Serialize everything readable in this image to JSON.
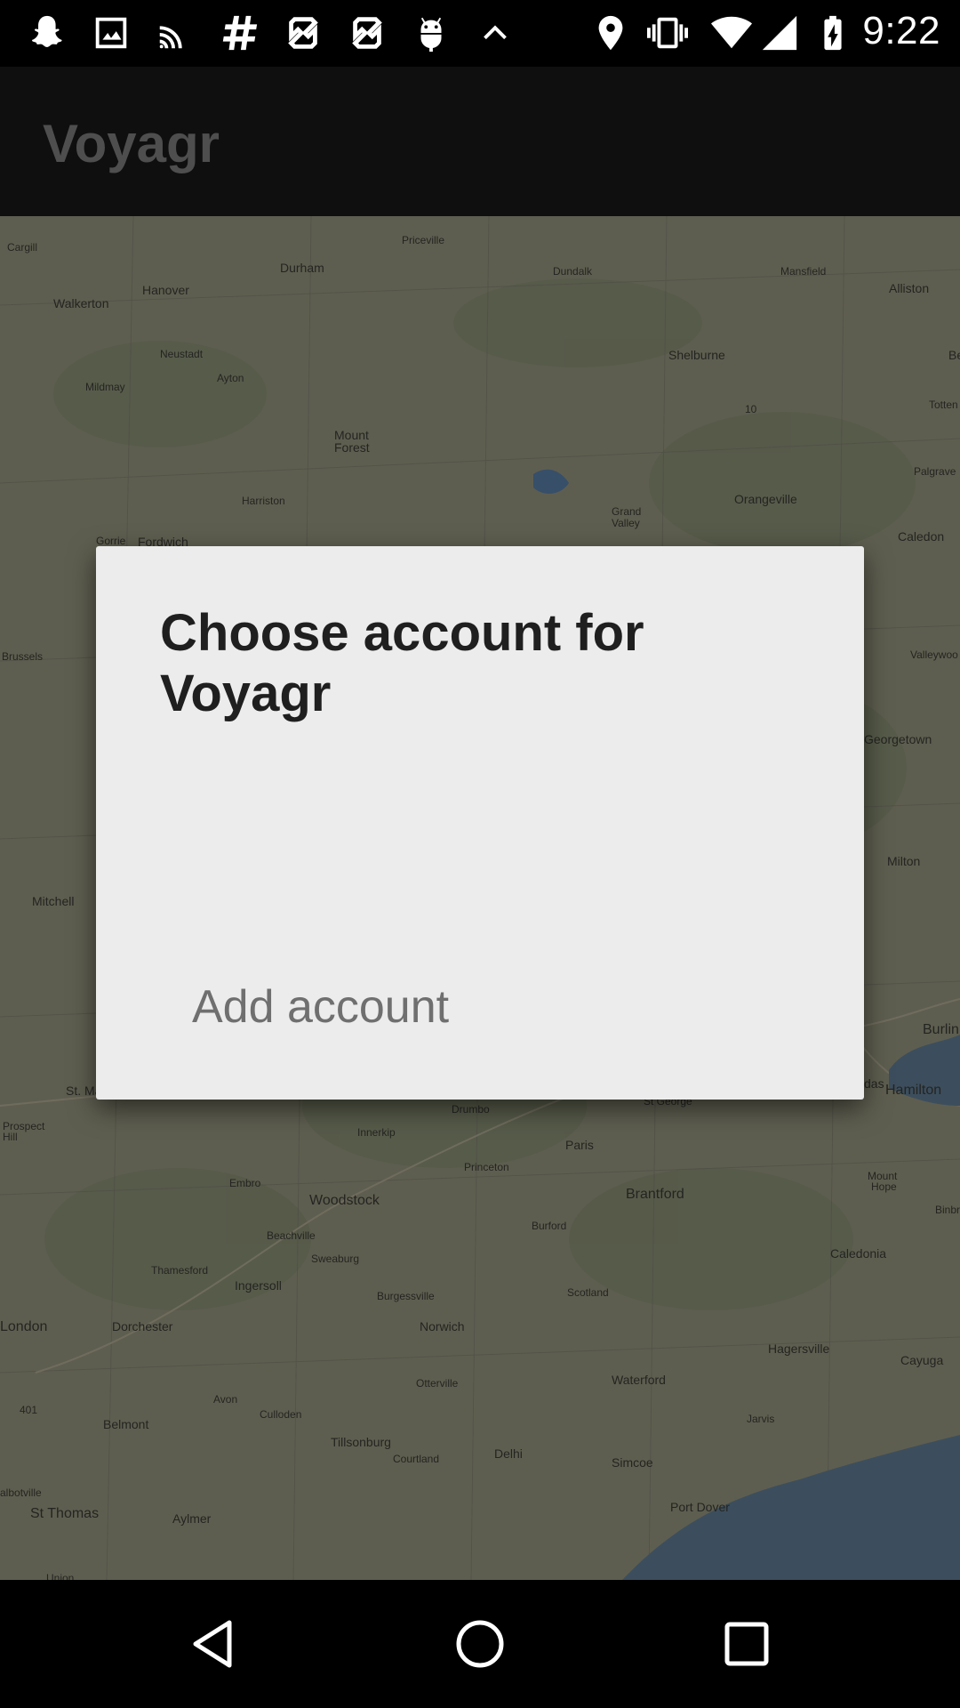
{
  "status_bar": {
    "time": "9:22",
    "icons": [
      "snapchat-icon",
      "gallery-icon",
      "cast-icon",
      "slack-icon",
      "sync-icon",
      "sync-icon",
      "android-debug-icon",
      "chevron-up-icon",
      "location-icon",
      "vibrate-icon",
      "wifi-icon",
      "signal-icon",
      "battery-charging-icon"
    ]
  },
  "app_bar": {
    "title": "Voyagr"
  },
  "map": {
    "labels": [
      {
        "text": "Cargill",
        "size": "sm"
      },
      {
        "text": "Priceville",
        "size": "sm"
      },
      {
        "text": "Durham",
        "size": "md"
      },
      {
        "text": "Dundalk",
        "size": "sm"
      },
      {
        "text": "Mansfield",
        "size": "sm"
      },
      {
        "text": "Alliston",
        "size": "md"
      },
      {
        "text": "Hanover",
        "size": "md"
      },
      {
        "text": "Walkerton",
        "size": "md"
      },
      {
        "text": "Neustadt",
        "size": "sm"
      },
      {
        "text": "Shelburne",
        "size": "md"
      },
      {
        "text": "Be",
        "size": "md"
      },
      {
        "text": "Mildmay",
        "size": "sm"
      },
      {
        "text": "Ayton",
        "size": "sm"
      },
      {
        "text": "10",
        "size": "sm"
      },
      {
        "text": "Totten",
        "size": "sm"
      },
      {
        "text": "Mount",
        "size": "md"
      },
      {
        "text": "Forest",
        "size": "md"
      },
      {
        "text": "Palgrave",
        "size": "sm"
      },
      {
        "text": "Harriston",
        "size": "sm"
      },
      {
        "text": "Orangeville",
        "size": "md"
      },
      {
        "text": "Grand",
        "size": "sm"
      },
      {
        "text": "Valley",
        "size": "sm"
      },
      {
        "text": "Gorrie",
        "size": "sm"
      },
      {
        "text": "Fordwich",
        "size": "md"
      },
      {
        "text": "Caledon",
        "size": "md"
      },
      {
        "text": "Brussels",
        "size": "sm"
      },
      {
        "text": "Valleywoo",
        "size": "sm"
      },
      {
        "text": "Georgetown",
        "size": "md"
      },
      {
        "text": "Milton",
        "size": "md"
      },
      {
        "text": "Mitchell",
        "size": "md"
      },
      {
        "text": "Burlin",
        "size": "lg"
      },
      {
        "text": "St. Ma",
        "size": "md"
      },
      {
        "text": "Drumbo",
        "size": "sm"
      },
      {
        "text": "St George",
        "size": "sm"
      },
      {
        "text": "das",
        "size": "md"
      },
      {
        "text": "Hamilton",
        "size": "lg"
      },
      {
        "text": "Prospect",
        "size": "sm"
      },
      {
        "text": "Hill",
        "size": "sm"
      },
      {
        "text": "Innerkip",
        "size": "sm"
      },
      {
        "text": "Paris",
        "size": "md"
      },
      {
        "text": "Princeton",
        "size": "sm"
      },
      {
        "text": "Mount",
        "size": "sm"
      },
      {
        "text": "Hope",
        "size": "sm"
      },
      {
        "text": "Embro",
        "size": "sm"
      },
      {
        "text": "Woodstock",
        "size": "lg"
      },
      {
        "text": "Brantford",
        "size": "lg"
      },
      {
        "text": "Binbr",
        "size": "sm"
      },
      {
        "text": "Burford",
        "size": "sm"
      },
      {
        "text": "Beachville",
        "size": "sm"
      },
      {
        "text": "Caledonia",
        "size": "md"
      },
      {
        "text": "Sweaburg",
        "size": "sm"
      },
      {
        "text": "Thamesford",
        "size": "sm"
      },
      {
        "text": "Ingersoll",
        "size": "md"
      },
      {
        "text": "Scotland",
        "size": "sm"
      },
      {
        "text": "Burgessville",
        "size": "sm"
      },
      {
        "text": "London",
        "size": "lg"
      },
      {
        "text": "Dorchester",
        "size": "md"
      },
      {
        "text": "Norwich",
        "size": "md"
      },
      {
        "text": "Hagersville",
        "size": "md"
      },
      {
        "text": "Cayuga",
        "size": "md"
      },
      {
        "text": "Otterville",
        "size": "sm"
      },
      {
        "text": "Waterford",
        "size": "md"
      },
      {
        "text": "Avon",
        "size": "sm"
      },
      {
        "text": "401",
        "size": "sm"
      },
      {
        "text": "Culloden",
        "size": "sm"
      },
      {
        "text": "Belmont",
        "size": "md"
      },
      {
        "text": "Jarvis",
        "size": "sm"
      },
      {
        "text": "Tillsonburg",
        "size": "md"
      },
      {
        "text": "Courtland",
        "size": "sm"
      },
      {
        "text": "Delhi",
        "size": "md"
      },
      {
        "text": "Simcoe",
        "size": "md"
      },
      {
        "text": "albotville",
        "size": "sm"
      },
      {
        "text": "Port Dover",
        "size": "md"
      },
      {
        "text": "St Thomas",
        "size": "lg"
      },
      {
        "text": "Aylmer",
        "size": "md"
      },
      {
        "text": "Union",
        "size": "sm"
      }
    ]
  },
  "dialog": {
    "title": "Choose account for Voyagr",
    "add_account_label": "Add account"
  },
  "nav_bar": {
    "icons": [
      "back-icon",
      "home-icon",
      "recents-icon"
    ]
  }
}
